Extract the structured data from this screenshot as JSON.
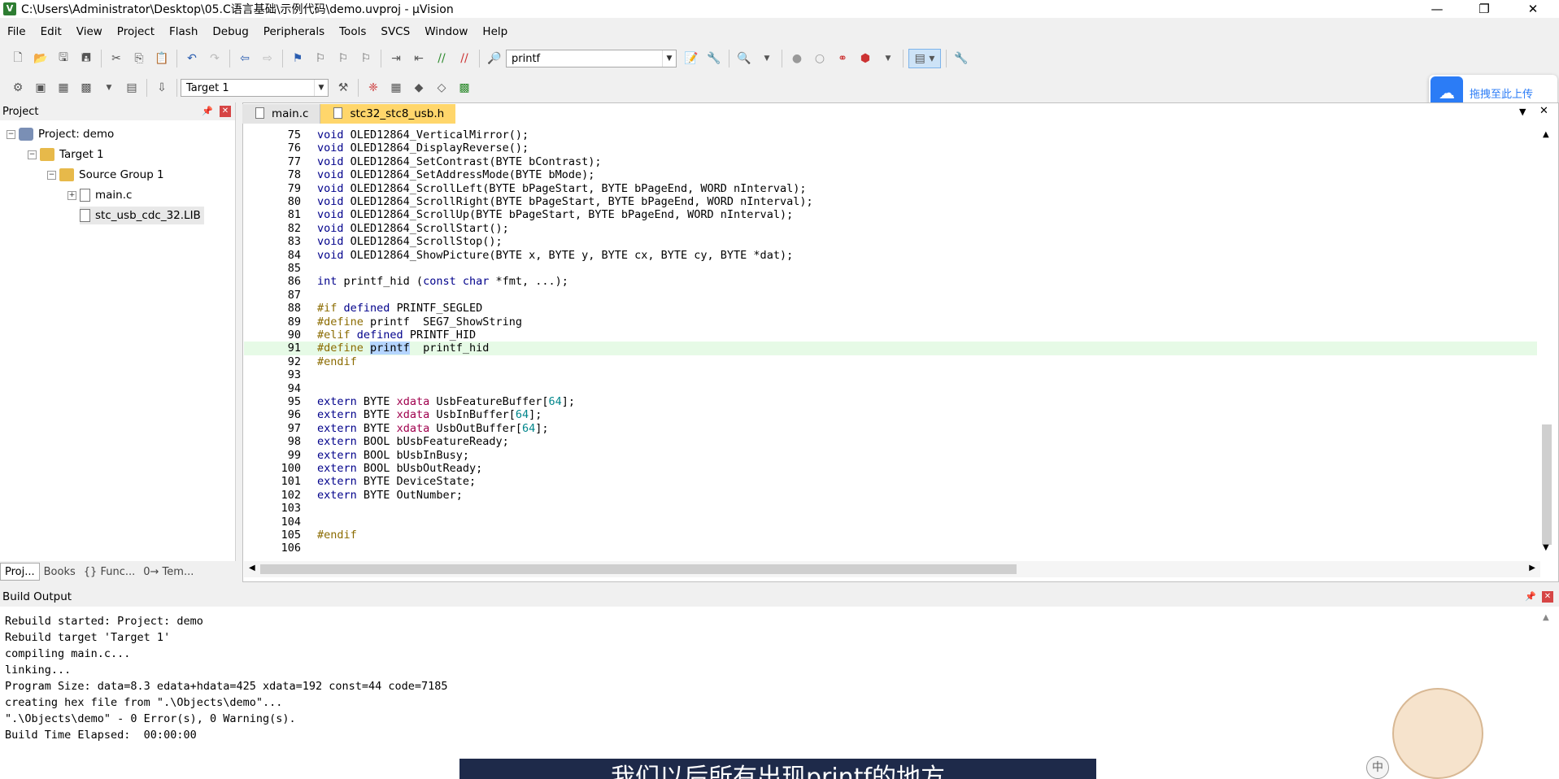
{
  "window": {
    "title": "C:\\Users\\Administrator\\Desktop\\05.C语言基础\\示例代码\\demo.uvproj - µVision",
    "app_icon": "V"
  },
  "menu": [
    "File",
    "Edit",
    "View",
    "Project",
    "Flash",
    "Debug",
    "Peripherals",
    "Tools",
    "SVCS",
    "Window",
    "Help"
  ],
  "toolbar": {
    "find_value": "printf",
    "target_value": "Target 1"
  },
  "upload_widget": {
    "label": "拖拽至此上传"
  },
  "project_panel": {
    "title": "Project",
    "tree": {
      "project": "Project: demo",
      "target": "Target 1",
      "group": "Source Group 1",
      "file1": "main.c",
      "file2": "stc_usb_cdc_32.LIB"
    },
    "tabs": [
      "Proj...",
      "Books",
      "{} Func...",
      "0→ Tem..."
    ]
  },
  "editor": {
    "tabs": [
      "main.c",
      "stc32_stc8_usb.h"
    ],
    "active_tab": 1,
    "highlight_line": "91",
    "lines": [
      {
        "n": "75",
        "t": "void OLED12864_VerticalMirror();"
      },
      {
        "n": "76",
        "t": "void OLED12864_DisplayReverse();"
      },
      {
        "n": "77",
        "t": "void OLED12864_SetContrast(BYTE bContrast);"
      },
      {
        "n": "78",
        "t": "void OLED12864_SetAddressMode(BYTE bMode);"
      },
      {
        "n": "79",
        "t": "void OLED12864_ScrollLeft(BYTE bPageStart, BYTE bPageEnd, WORD nInterval);"
      },
      {
        "n": "80",
        "t": "void OLED12864_ScrollRight(BYTE bPageStart, BYTE bPageEnd, WORD nInterval);"
      },
      {
        "n": "81",
        "t": "void OLED12864_ScrollUp(BYTE bPageStart, BYTE bPageEnd, WORD nInterval);"
      },
      {
        "n": "82",
        "t": "void OLED12864_ScrollStart();"
      },
      {
        "n": "83",
        "t": "void OLED12864_ScrollStop();"
      },
      {
        "n": "84",
        "t": "void OLED12864_ShowPicture(BYTE x, BYTE y, BYTE cx, BYTE cy, BYTE *dat);"
      },
      {
        "n": "85",
        "t": ""
      },
      {
        "n": "86",
        "t": "int printf_hid (const char *fmt, ...);"
      },
      {
        "n": "87",
        "t": ""
      },
      {
        "n": "88",
        "t": "#if defined PRINTF_SEGLED"
      },
      {
        "n": "89",
        "t": "#define printf  SEG7_ShowString"
      },
      {
        "n": "90",
        "t": "#elif defined PRINTF_HID"
      },
      {
        "n": "91",
        "t": "#define printf  printf_hid"
      },
      {
        "n": "92",
        "t": "#endif"
      },
      {
        "n": "93",
        "t": ""
      },
      {
        "n": "94",
        "t": ""
      },
      {
        "n": "95",
        "t": "extern BYTE xdata UsbFeatureBuffer[64];"
      },
      {
        "n": "96",
        "t": "extern BYTE xdata UsbInBuffer[64];"
      },
      {
        "n": "97",
        "t": "extern BYTE xdata UsbOutBuffer[64];"
      },
      {
        "n": "98",
        "t": "extern BOOL bUsbFeatureReady;"
      },
      {
        "n": "99",
        "t": "extern BOOL bUsbInBusy;"
      },
      {
        "n": "100",
        "t": "extern BOOL bUsbOutReady;"
      },
      {
        "n": "101",
        "t": "extern BYTE DeviceState;"
      },
      {
        "n": "102",
        "t": "extern BYTE OutNumber;"
      },
      {
        "n": "103",
        "t": ""
      },
      {
        "n": "104",
        "t": ""
      },
      {
        "n": "105",
        "t": "#endif"
      },
      {
        "n": "106",
        "t": ""
      }
    ]
  },
  "build_output": {
    "title": "Build Output",
    "lines": [
      "Rebuild started: Project: demo",
      "Rebuild target 'Target 1'",
      "compiling main.c...",
      "linking...",
      "Program Size: data=8.3 edata+hdata=425 xdata=192 const=44 code=7185",
      "creating hex file from \".\\Objects\\demo\"...",
      "\".\\Objects\\demo\" - 0 Error(s), 0 Warning(s).",
      "Build Time Elapsed:  00:00:00"
    ]
  },
  "caption": "我们以后所有出现printf的地方",
  "ime_indicator": "中",
  "colors": {
    "active_tab": "#ffd66b",
    "highlight_line": "#e6fae6",
    "keyword": "#00008b",
    "preprocessor": "#8b6b00",
    "upload_blue": "#2b7cf6",
    "close_red": "#d64545"
  }
}
